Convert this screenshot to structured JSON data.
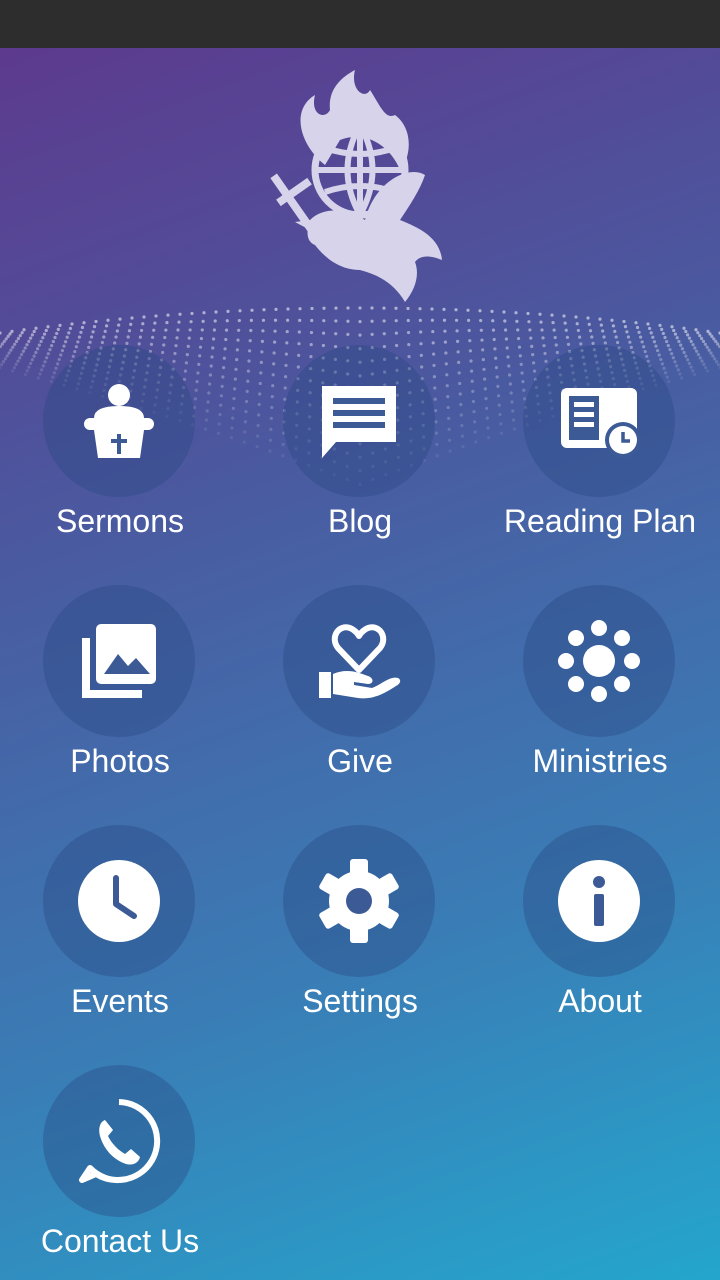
{
  "colors": {
    "status_bar": "#2d2d2d",
    "gradient_top": "#5d3a8e",
    "gradient_bottom": "#24a6cc",
    "icon": "#ffffff",
    "logo": "#d6d3ea"
  },
  "logo": {
    "icon": "dove-globe-flame-logo"
  },
  "menu": [
    {
      "label": "Sermons",
      "icon": "pulpit-icon"
    },
    {
      "label": "Blog",
      "icon": "chat-lines-icon"
    },
    {
      "label": "Reading Plan",
      "icon": "document-clock-icon"
    },
    {
      "label": "Photos",
      "icon": "photo-library-icon"
    },
    {
      "label": "Give",
      "icon": "heart-hand-icon"
    },
    {
      "label": "Ministries",
      "icon": "dots-cluster-icon"
    },
    {
      "label": "Events",
      "icon": "clock-icon"
    },
    {
      "label": "Settings",
      "icon": "gear-icon"
    },
    {
      "label": "About",
      "icon": "info-icon"
    },
    {
      "label": "Contact Us",
      "icon": "phone-icon"
    }
  ]
}
